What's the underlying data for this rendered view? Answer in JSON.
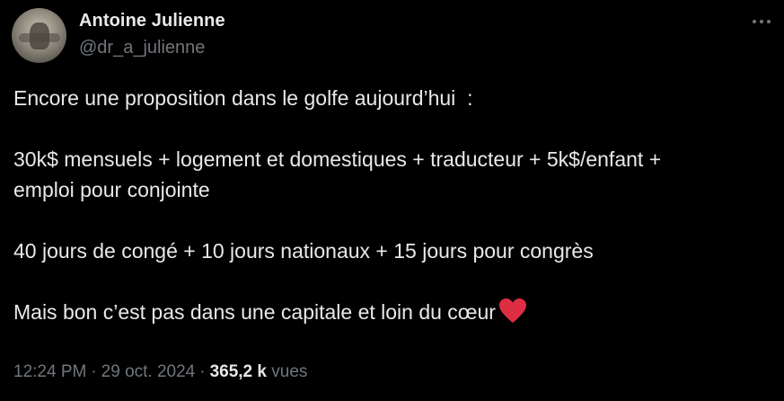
{
  "author": {
    "display_name": "Antoine Julienne",
    "handle": "@dr_a_julienne"
  },
  "tweet": {
    "line1": "Encore une proposition dans le golfe aujourd’hui  :",
    "line2": "30k$ mensuels + logement et domestiques + traducteur + 5k$/enfant +",
    "line3": "emploi pour conjointe",
    "line4": "40 jours de congé + 10 jours nationaux + 15 jours pour congrès",
    "line5": "Mais bon c’est pas dans une capitale et loin du cœur",
    "heart_icon": "red-heart-emoji",
    "heart_color": "#f91880"
  },
  "meta": {
    "time": "12:24 PM",
    "separator": "·",
    "date": "29 oct. 2024",
    "views_count": "365,2 k",
    "views_label": "vues"
  },
  "colors": {
    "background": "#000000",
    "primary_text": "#e7e9ea",
    "secondary_text": "#71767b"
  }
}
